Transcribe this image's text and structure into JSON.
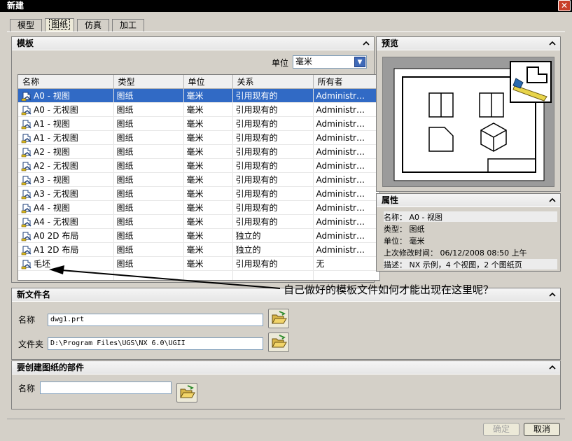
{
  "window": {
    "title": "新建",
    "close_glyph": "✕"
  },
  "tabs": [
    {
      "label": "模型"
    },
    {
      "label": "图纸"
    },
    {
      "label": "仿真"
    },
    {
      "label": "加工"
    }
  ],
  "active_tab": "图纸",
  "templates": {
    "header": "模板",
    "unit_label": "单位",
    "unit_value": "毫米",
    "columns": [
      "名称",
      "类型",
      "单位",
      "关系",
      "所有者"
    ],
    "rows": [
      {
        "name": "A0 - 视图",
        "type": "图纸",
        "unit": "毫米",
        "relation": "引用现有的",
        "owner": "Administr…"
      },
      {
        "name": "A0 - 无视图",
        "type": "图纸",
        "unit": "毫米",
        "relation": "引用现有的",
        "owner": "Administr…"
      },
      {
        "name": "A1 - 视图",
        "type": "图纸",
        "unit": "毫米",
        "relation": "引用现有的",
        "owner": "Administr…"
      },
      {
        "name": "A1 - 无视图",
        "type": "图纸",
        "unit": "毫米",
        "relation": "引用现有的",
        "owner": "Administr…"
      },
      {
        "name": "A2 - 视图",
        "type": "图纸",
        "unit": "毫米",
        "relation": "引用现有的",
        "owner": "Administr…"
      },
      {
        "name": "A2 - 无视图",
        "type": "图纸",
        "unit": "毫米",
        "relation": "引用现有的",
        "owner": "Administr…"
      },
      {
        "name": "A3 - 视图",
        "type": "图纸",
        "unit": "毫米",
        "relation": "引用现有的",
        "owner": "Administr…"
      },
      {
        "name": "A3 - 无视图",
        "type": "图纸",
        "unit": "毫米",
        "relation": "引用现有的",
        "owner": "Administr…"
      },
      {
        "name": "A4 - 视图",
        "type": "图纸",
        "unit": "毫米",
        "relation": "引用现有的",
        "owner": "Administr…"
      },
      {
        "name": "A4 - 无视图",
        "type": "图纸",
        "unit": "毫米",
        "relation": "引用现有的",
        "owner": "Administr…"
      },
      {
        "name": "A0 2D 布局",
        "type": "图纸",
        "unit": "毫米",
        "relation": "独立的",
        "owner": "Administr…"
      },
      {
        "name": "A1 2D 布局",
        "type": "图纸",
        "unit": "毫米",
        "relation": "独立的",
        "owner": "Administr…"
      },
      {
        "name": "毛坯",
        "type": "图纸",
        "unit": "毫米",
        "relation": "引用现有的",
        "owner": "无"
      }
    ],
    "selected_index": 0,
    "row_icon": "drawing-template-icon"
  },
  "preview": {
    "header": "预览"
  },
  "properties": {
    "header": "属性",
    "lines": [
      "名称： A0 - 视图",
      "类型： 图纸",
      "单位： 毫米",
      "上次修改时间： 06/12/2008 08:50 上午",
      "描述： NX 示例，4 个视图，2 个图纸页"
    ]
  },
  "new_file": {
    "header": "新文件名",
    "name_label": "名称",
    "name_value": "dwg1.prt",
    "folder_label": "文件夹",
    "folder_value": "D:\\Program Files\\UGS\\NX 6.0\\UGII",
    "browse_icon": "open-folder-icon"
  },
  "part": {
    "header": "要创建图纸的部件",
    "name_label": "名称",
    "name_value": ""
  },
  "buttons": {
    "ok": "确定",
    "cancel": "取消"
  },
  "annotation": {
    "text": "自己做好的模板文件如何才能出现在这里呢？"
  },
  "colors": {
    "selection": "#316ac5",
    "title_bar": "#000000",
    "dialog_bg": "#d4d0c8"
  }
}
